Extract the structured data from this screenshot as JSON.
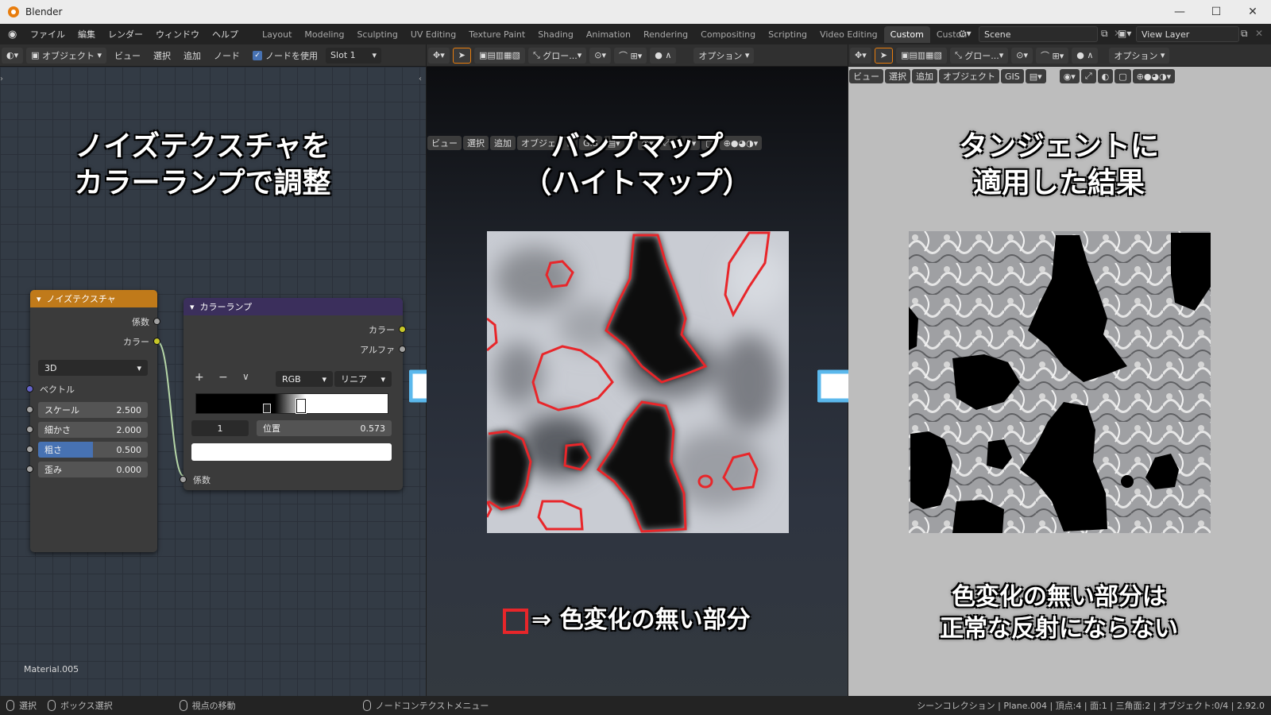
{
  "window": {
    "title": "Blender"
  },
  "menu": {
    "items": [
      "ファイル",
      "編集",
      "レンダー",
      "ウィンドウ",
      "ヘルプ"
    ]
  },
  "workspaces": {
    "tabs": [
      "Layout",
      "Modeling",
      "Sculpting",
      "UV Editing",
      "Texture Paint",
      "Shading",
      "Animation",
      "Rendering",
      "Compositing",
      "Scripting",
      "Video Editing",
      "Custom",
      "Custon"
    ],
    "active": "Custom"
  },
  "scene": {
    "name": "Scene",
    "view_layer": "View Layer"
  },
  "node_header": {
    "mode": "オブジェクト",
    "view": "ビュー",
    "select": "選択",
    "add": "追加",
    "node": "ノード",
    "use_nodes": "ノードを使用",
    "slot": "Slot 1"
  },
  "viewport_header": {
    "global": "グロー...",
    "options": "オプション",
    "view": "ビュー",
    "select": "選択",
    "add": "追加",
    "object": "オブジェクト",
    "gis": "GIS"
  },
  "panel1": {
    "title_line1": "ノイズテクスチャを",
    "title_line2": "カラーランプで調整",
    "material": "Material.005"
  },
  "noise_node": {
    "title": "ノイズテクスチャ",
    "out_fac": "係数",
    "out_color": "カラー",
    "dimension": "3D",
    "vector": "ベクトル",
    "fields": [
      {
        "label": "スケール",
        "value": "2.500"
      },
      {
        "label": "細かさ",
        "value": "2.000"
      },
      {
        "label": "粗さ",
        "value": "0.500"
      },
      {
        "label": "歪み",
        "value": "0.000"
      }
    ],
    "roughness_fill": 0.5
  },
  "ramp_node": {
    "title": "カラーランプ",
    "out_color": "カラー",
    "out_alpha": "アルファ",
    "plus": "+",
    "minus": "−",
    "chevron": "∨",
    "color_mode": "RGB",
    "interpolation": "リニア",
    "index": "1",
    "pos_label": "位置",
    "pos_value": "0.573",
    "in_fac": "係数"
  },
  "panel2": {
    "title_line1": "バンプマップ",
    "title_line2": "（ハイトマップ）",
    "legend": "⇒ 色変化の無い部分"
  },
  "panel3": {
    "title_line1": "タンジェントに",
    "title_line2": "適用した結果",
    "note_line1": "色変化の無い部分は",
    "note_line2": "正常な反射にならない"
  },
  "status": {
    "select": "選択",
    "box_select": "ボックス選択",
    "pan": "視点の移動",
    "context": "ノードコンテクストメニュー",
    "info": "シーンコレクション | Plane.004 | 頂点:4 | 面:1 | 三角面:2 | オブジェクト:0/4 | 2.92.0"
  },
  "colors": {
    "noise_header": "#c07a1a",
    "ramp_header": "#3b2f5c",
    "arrow": "#5bb8ec",
    "outline": "#e8262a"
  }
}
